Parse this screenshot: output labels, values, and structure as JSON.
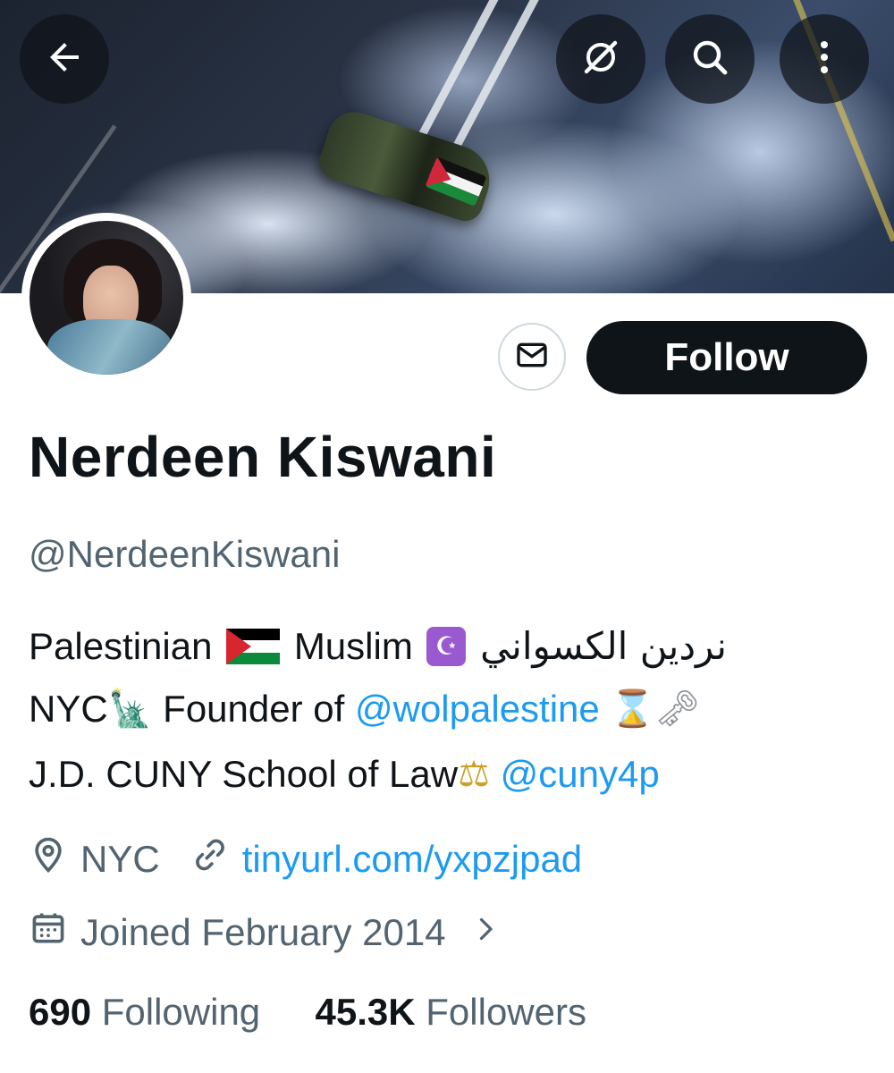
{
  "header": {
    "back_icon": "arrow-left-icon",
    "action_icons": [
      "grok-icon",
      "search-icon",
      "more-vertical-icon"
    ]
  },
  "profile": {
    "name": "Nerdeen Kiswani",
    "handle": "@NerdeenKiswani",
    "follow_label": "Follow",
    "message_icon": "envelope-icon",
    "bio": {
      "line1": {
        "word1": "Palestinian",
        "flag_emoji": "palestine-flag",
        "word2": "Muslim",
        "symbol_emoji": "☪",
        "arabic_name": "نردين الكسواني"
      },
      "line2": {
        "city": "NYC",
        "statue_emoji": "🗽",
        "text": "Founder of",
        "mention": "@wolpalestine",
        "hourglass_emoji": "⌛",
        "key_emoji": "🗝"
      },
      "line3": {
        "text": "J.D. CUNY School of Law",
        "scales_emoji": "⚖",
        "mention": "@cuny4p"
      }
    },
    "location": "NYC",
    "website": "tinyurl.com/yxpzjpad",
    "joined": "Joined February 2014",
    "following_count": "690",
    "following_label": "Following",
    "followers_count": "45.3K",
    "followers_label": "Followers"
  },
  "colors": {
    "link": "#1d9bf0",
    "secondary_text": "#536471",
    "primary_text": "#0f1419",
    "follow_bg": "#0f1419"
  }
}
